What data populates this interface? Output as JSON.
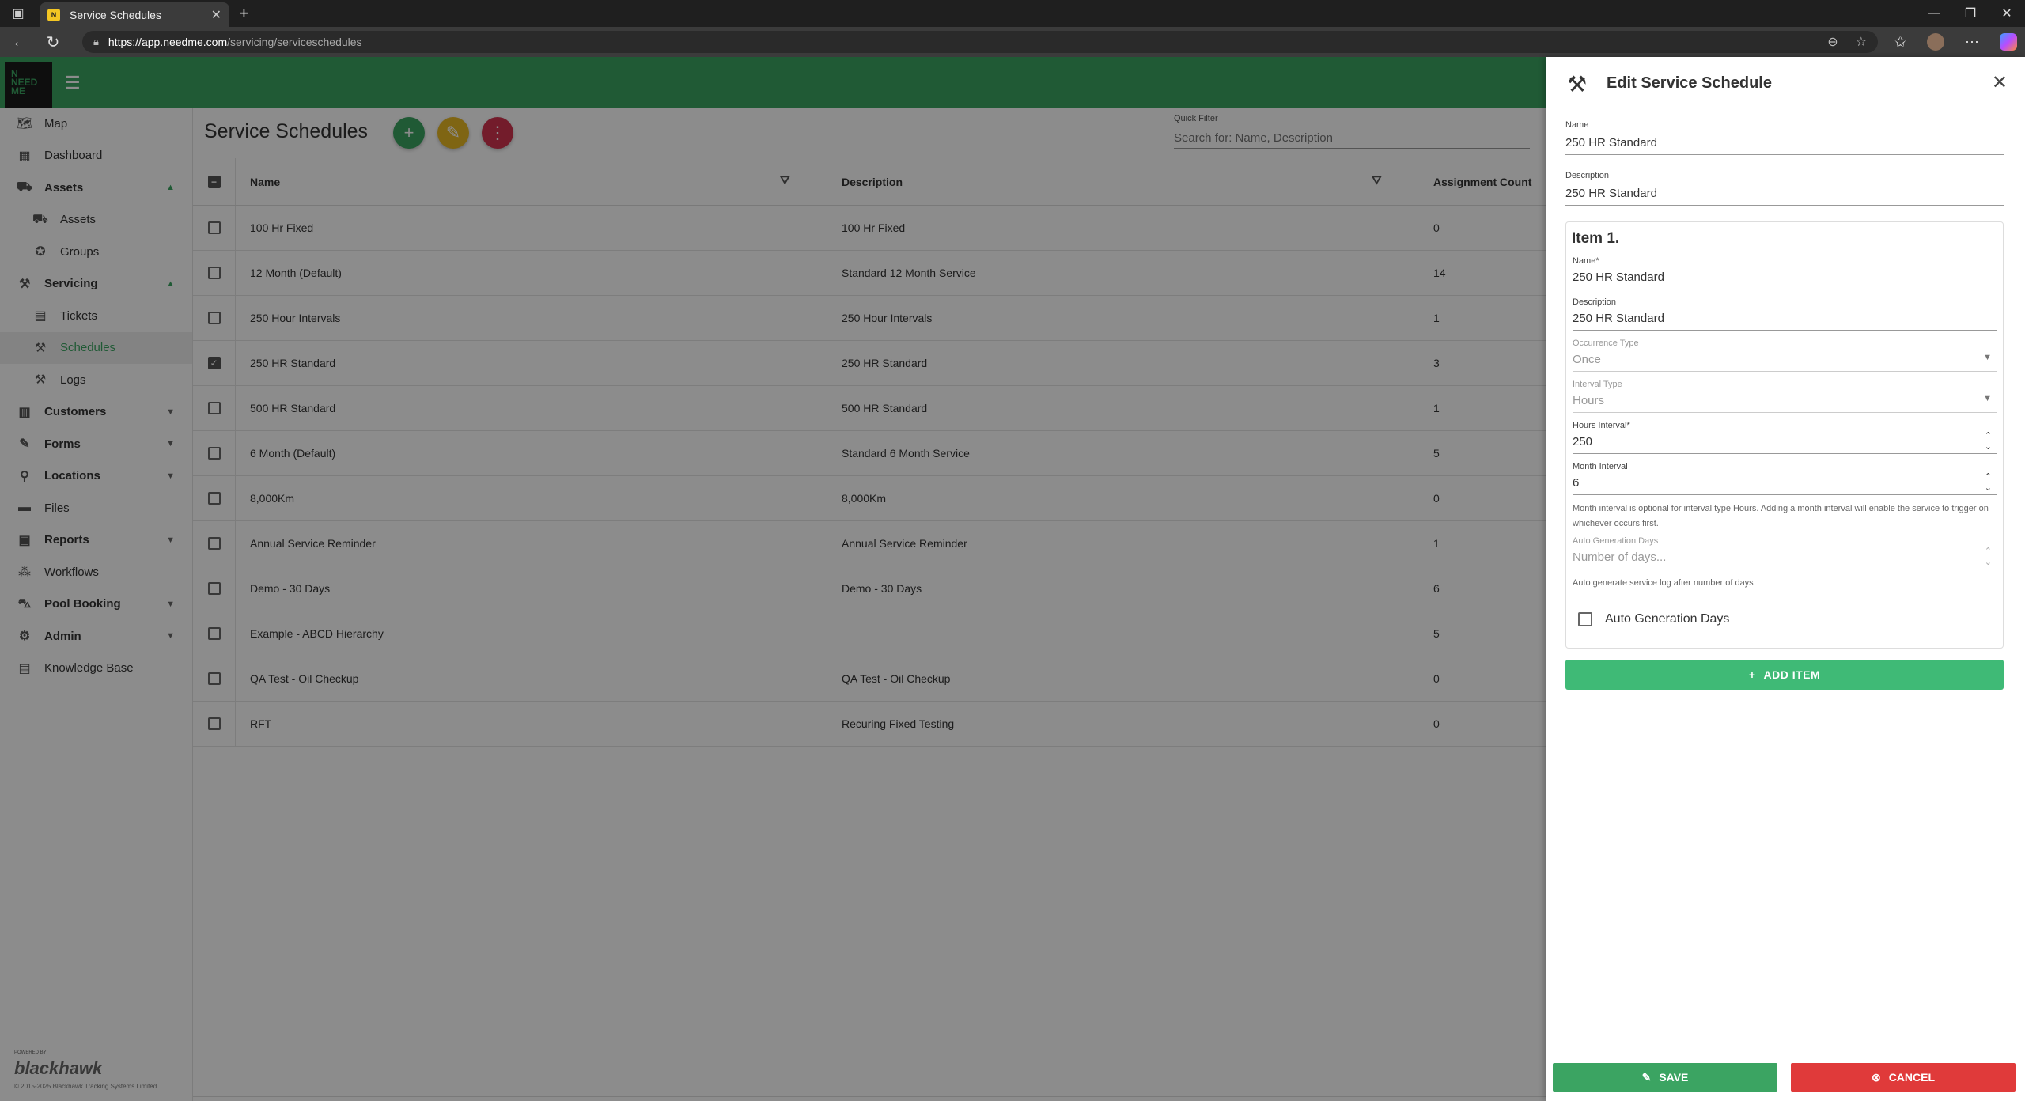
{
  "browser": {
    "tab_title": "Service Schedules",
    "url_host": "https://app.needme.com",
    "url_path": "/servicing/serviceschedules"
  },
  "sidebar": {
    "items": [
      {
        "label": "Map",
        "icon": "map-icon"
      },
      {
        "label": "Dashboard",
        "icon": "dashboard-icon"
      },
      {
        "label": "Assets",
        "icon": "truck-icon"
      },
      {
        "label": "Assets",
        "icon": "truck-icon"
      },
      {
        "label": "Groups",
        "icon": "groups-icon"
      },
      {
        "label": "Servicing",
        "icon": "tools-icon"
      },
      {
        "label": "Tickets",
        "icon": "ticket-icon"
      },
      {
        "label": "Schedules",
        "icon": "tools-icon"
      },
      {
        "label": "Logs",
        "icon": "tools-icon"
      },
      {
        "label": "Customers",
        "icon": "building-icon"
      },
      {
        "label": "Forms",
        "icon": "forms-icon"
      },
      {
        "label": "Locations",
        "icon": "location-icon"
      },
      {
        "label": "Files",
        "icon": "folder-icon"
      },
      {
        "label": "Reports",
        "icon": "reports-icon"
      },
      {
        "label": "Workflows",
        "icon": "workflow-icon"
      },
      {
        "label": "Pool Booking",
        "icon": "car-icon"
      },
      {
        "label": "Admin",
        "icon": "admin-icon"
      },
      {
        "label": "Knowledge Base",
        "icon": "book-icon"
      }
    ],
    "powered_by": "POWERED BY",
    "brand": "blackhawk",
    "copyright": "© 2015-2025 Blackhawk Tracking Systems Limited"
  },
  "main": {
    "title": "Service Schedules",
    "quick_filter_label": "Quick Filter",
    "quick_filter_placeholder": "Search for: Name, Description",
    "columns": [
      "Name",
      "Description",
      "Assignment Count"
    ],
    "rows": [
      {
        "name": "100 Hr Fixed",
        "description": "100 Hr Fixed",
        "count": "0",
        "checked": false
      },
      {
        "name": "12 Month (Default)",
        "description": "Standard 12 Month Service",
        "count": "14",
        "checked": false
      },
      {
        "name": "250 Hour Intervals",
        "description": "250 Hour Intervals",
        "count": "1",
        "checked": false
      },
      {
        "name": "250 HR Standard",
        "description": "250 HR Standard",
        "count": "3",
        "checked": true
      },
      {
        "name": "500 HR Standard",
        "description": "500 HR Standard",
        "count": "1",
        "checked": false
      },
      {
        "name": "6 Month (Default)",
        "description": "Standard 6 Month Service",
        "count": "5",
        "checked": false
      },
      {
        "name": "8,000Km",
        "description": "8,000Km",
        "count": "0",
        "checked": false
      },
      {
        "name": "Annual Service Reminder",
        "description": "Annual Service Reminder",
        "count": "1",
        "checked": false
      },
      {
        "name": "Demo - 30 Days",
        "description": "Demo - 30 Days",
        "count": "6",
        "checked": false
      },
      {
        "name": "Example - ABCD Hierarchy",
        "description": "",
        "count": "5",
        "checked": false
      },
      {
        "name": "QA Test - Oil Checkup",
        "description": "QA Test - Oil Checkup",
        "count": "0",
        "checked": false
      },
      {
        "name": "RFT",
        "description": "Recuring Fixed Testing",
        "count": "0",
        "checked": false
      }
    ]
  },
  "panel": {
    "title": "Edit Service Schedule",
    "name_label": "Name",
    "name_value": "250 HR Standard",
    "description_label": "Description",
    "description_value": "250 HR Standard",
    "item_title": "Item 1.",
    "item_name_label": "Name*",
    "item_name_value": "250 HR Standard",
    "item_description_label": "Description",
    "item_description_value": "250 HR Standard",
    "occurrence_label": "Occurrence Type",
    "occurrence_value": "Once",
    "interval_type_label": "Interval Type",
    "interval_type_value": "Hours",
    "hours_interval_label": "Hours Interval*",
    "hours_interval_value": "250",
    "month_interval_label": "Month Interval",
    "month_interval_value": "6",
    "month_helper": "Month interval is optional for interval type Hours. Adding a month interval will enable the service to trigger on whichever occurs first.",
    "auto_gen_label": "Auto Generation Days",
    "auto_gen_placeholder": "Number of days...",
    "auto_gen_helper": "Auto generate service log after number of days",
    "auto_gen_checkbox": "Auto Generation Days",
    "add_item": "ADD ITEM",
    "save": "SAVE",
    "cancel": "CANCEL"
  },
  "colors": {
    "brand_green": "#3ba462",
    "fab_add": "#3ba462",
    "fab_edit": "#e8b824",
    "fab_more": "#d2334f",
    "cancel_red": "#e03a3a"
  }
}
